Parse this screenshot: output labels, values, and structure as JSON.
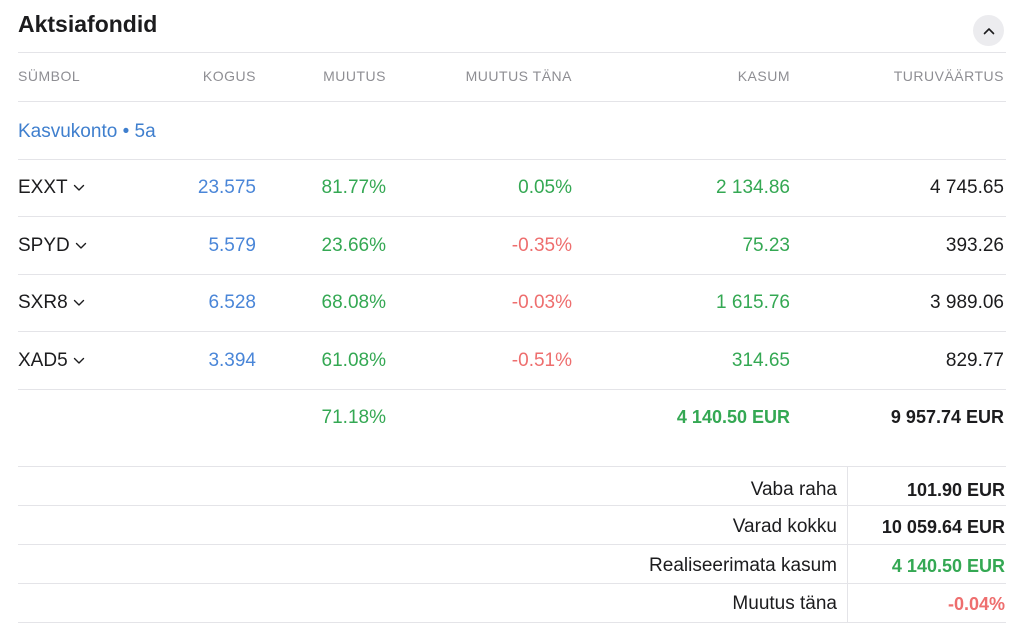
{
  "header": {
    "title": "Aktsiafondid"
  },
  "columns": [
    "SÜMBOL",
    "KOGUS",
    "MUUTUS",
    "MUUTUS TÄNA",
    "KASUM",
    "TURUVÄÄRTUS"
  ],
  "group": {
    "label": "Kasvukonto • 5a"
  },
  "rows": [
    {
      "symbol": "EXXT",
      "quantity": "23.575",
      "change": "81.77%",
      "change_today": "0.05%",
      "profit": "2 134.86",
      "market_value": "4 745.65",
      "change_today_color": "green"
    },
    {
      "symbol": "SPYD",
      "quantity": "5.579",
      "change": "23.66%",
      "change_today": "-0.35%",
      "profit": "75.23",
      "market_value": "393.26",
      "change_today_color": "red"
    },
    {
      "symbol": "SXR8",
      "quantity": "6.528",
      "change": "68.08%",
      "change_today": "-0.03%",
      "profit": "1 615.76",
      "market_value": "3 989.06",
      "change_today_color": "red"
    },
    {
      "symbol": "XAD5",
      "quantity": "3.394",
      "change": "61.08%",
      "change_today": "-0.51%",
      "profit": "314.65",
      "market_value": "829.77",
      "change_today_color": "red"
    }
  ],
  "totals": {
    "change": "71.18%",
    "profit": "4 140.50 EUR",
    "market_value": "9 957.74 EUR"
  },
  "summary": [
    {
      "label": "Vaba raha",
      "value": "101.90 EUR",
      "color": "dark"
    },
    {
      "label": "Varad kokku",
      "value": "10 059.64 EUR",
      "color": "dark"
    },
    {
      "label": "Realiseerimata kasum",
      "value": "4 140.50 EUR",
      "color": "green"
    },
    {
      "label": "Muutus täna",
      "value": "-0.04%",
      "color": "red"
    }
  ],
  "colors": {
    "green": "#34a853",
    "red": "#ee6e6e",
    "blue": "#4a86d8",
    "link": "#3f7fce"
  },
  "icons": {
    "collapse": "chevron-up-icon",
    "row_expand": "chevron-down-icon"
  }
}
